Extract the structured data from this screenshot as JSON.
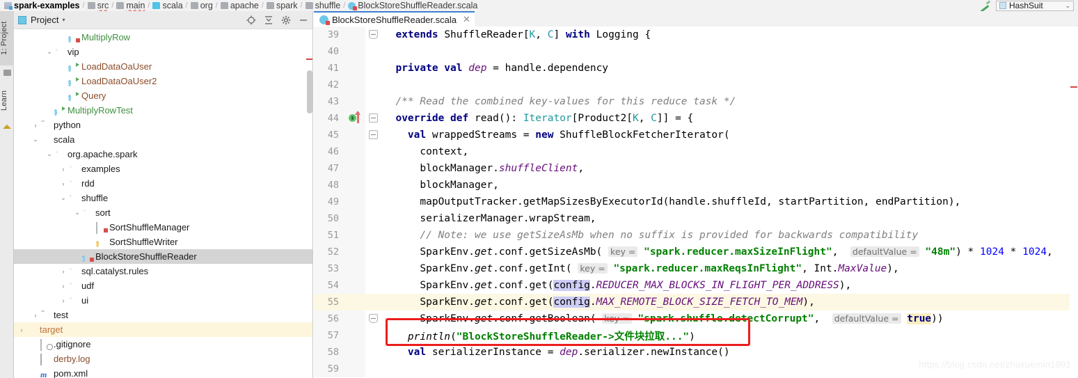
{
  "breadcrumb": {
    "items": [
      {
        "label": "spark-examples",
        "icon": "module-icon",
        "style": "bold"
      },
      {
        "label": "src",
        "icon": "folder-grey-icon",
        "style": "warn"
      },
      {
        "label": "main",
        "icon": "folder-grey-icon",
        "style": "warn"
      },
      {
        "label": "scala",
        "icon": "folder-blue-icon",
        "style": "plain"
      },
      {
        "label": "org",
        "icon": "folder-pkg-icon",
        "style": "plain"
      },
      {
        "label": "apache",
        "icon": "folder-pkg-icon",
        "style": "plain"
      },
      {
        "label": "spark",
        "icon": "folder-pkg-icon",
        "style": "plain"
      },
      {
        "label": "shuffle",
        "icon": "folder-pkg-icon",
        "style": "plain"
      },
      {
        "label": "BlockStoreShuffleReader.scala",
        "icon": "scala-file-icon",
        "style": "plain"
      }
    ],
    "separator": "/"
  },
  "toolbar_right": {
    "magic_wand_icon": "wand-icon",
    "run_configuration": "HashSuit",
    "run_config_chevron": "⌄"
  },
  "tool_window_bar": {
    "tabs": [
      {
        "label": "1: Project",
        "active": true
      },
      {
        "label": "Learn",
        "active": false
      }
    ]
  },
  "project_panel": {
    "title": "Project",
    "title_chevron": "▾",
    "tools": [
      "locate-icon",
      "collapse-all-icon",
      "settings-icon",
      "minimize-icon"
    ],
    "tree": [
      {
        "indent": 5,
        "arrow": "",
        "icon": "scala-class-icon",
        "label": "MultiplyRow",
        "color": "green",
        "state": ""
      },
      {
        "indent": 4,
        "arrow": "⌄",
        "icon": "folder-pkg-icon",
        "label": "vip",
        "color": "dark",
        "state": ""
      },
      {
        "indent": 5,
        "arrow": "",
        "icon": "scala-class-run-icon",
        "label": "LoadDataOaUser",
        "color": "brown",
        "state": ""
      },
      {
        "indent": 5,
        "arrow": "",
        "icon": "scala-class-run-icon",
        "label": "LoadDataOaUser2",
        "color": "brown",
        "state": ""
      },
      {
        "indent": 5,
        "arrow": "",
        "icon": "scala-class-run-icon",
        "label": "Query",
        "color": "brown",
        "state": ""
      },
      {
        "indent": 4,
        "arrow": "",
        "icon": "scala-class-run-icon",
        "label": "MultiplyRowTest",
        "color": "green",
        "state": ""
      },
      {
        "indent": 3,
        "arrow": "›",
        "icon": "folder-grey-icon",
        "label": "python",
        "color": "dark",
        "state": ""
      },
      {
        "indent": 3,
        "arrow": "⌄",
        "icon": "folder-blue-icon",
        "label": "scala",
        "color": "dark",
        "state": ""
      },
      {
        "indent": 4,
        "arrow": "⌄",
        "icon": "folder-pkg-icon",
        "label": "org.apache.spark",
        "color": "dark",
        "state": ""
      },
      {
        "indent": 5,
        "arrow": "›",
        "icon": "folder-pkg-icon",
        "label": "examples",
        "color": "dark",
        "state": ""
      },
      {
        "indent": 5,
        "arrow": "›",
        "icon": "folder-pkg-icon",
        "label": "rdd",
        "color": "dark",
        "state": ""
      },
      {
        "indent": 5,
        "arrow": "⌄",
        "icon": "folder-pkg-icon",
        "label": "shuffle",
        "color": "dark",
        "state": ""
      },
      {
        "indent": 6,
        "arrow": "⌄",
        "icon": "folder-pkg-icon",
        "label": "sort",
        "color": "dark",
        "state": ""
      },
      {
        "indent": 7,
        "arrow": "",
        "icon": "scala-file-icon",
        "label": "SortShuffleManager",
        "color": "dark",
        "state": ""
      },
      {
        "indent": 7,
        "arrow": "",
        "icon": "scala-object-icon",
        "label": "SortShuffleWriter",
        "color": "dark",
        "state": ""
      },
      {
        "indent": 6,
        "arrow": "",
        "icon": "scala-class-icon",
        "label": "BlockStoreShuffleReader",
        "color": "dark",
        "state": "selected"
      },
      {
        "indent": 5,
        "arrow": "›",
        "icon": "folder-pkg-icon",
        "label": "sql.catalyst.rules",
        "color": "dark",
        "state": ""
      },
      {
        "indent": 5,
        "arrow": "›",
        "icon": "folder-pkg-icon",
        "label": "udf",
        "color": "dark",
        "state": ""
      },
      {
        "indent": 5,
        "arrow": "›",
        "icon": "folder-pkg-icon",
        "label": "ui",
        "color": "dark",
        "state": ""
      },
      {
        "indent": 3,
        "arrow": "›",
        "icon": "folder-grey-icon",
        "label": "test",
        "color": "dark",
        "state": ""
      },
      {
        "indent": 2,
        "arrow": "›",
        "icon": "folder-orange-icon",
        "label": "target",
        "color": "orange",
        "state": "highlighted"
      },
      {
        "indent": 3,
        "arrow": "",
        "icon": "gitignore-icon",
        "label": ".gitignore",
        "color": "dark",
        "state": ""
      },
      {
        "indent": 3,
        "arrow": "",
        "icon": "log-file-icon",
        "label": "derby.log",
        "color": "brown",
        "state": ""
      },
      {
        "indent": 3,
        "arrow": "",
        "icon": "maven-icon",
        "label": "pom.xml",
        "color": "dark",
        "state": ""
      }
    ]
  },
  "editor": {
    "tab": {
      "label": "BlockStoreShuffleReader.scala",
      "close": "✕",
      "icon": "scala-class-icon"
    },
    "lines": [
      {
        "num": "39",
        "gutter": "",
        "fold": "pointy",
        "hl": false,
        "tokens": [
          {
            "t": "  ",
            "c": ""
          },
          {
            "t": "extends ",
            "c": "kw"
          },
          {
            "t": "ShuffleReader",
            "c": ""
          },
          {
            "t": "[",
            "c": ""
          },
          {
            "t": "K",
            "c": "typ"
          },
          {
            "t": ", ",
            "c": ""
          },
          {
            "t": "C",
            "c": "typ"
          },
          {
            "t": "] ",
            "c": ""
          },
          {
            "t": "with ",
            "c": "kw"
          },
          {
            "t": "Logging {",
            "c": ""
          }
        ]
      },
      {
        "num": "40",
        "gutter": "",
        "fold": "",
        "hl": false,
        "tokens": []
      },
      {
        "num": "41",
        "gutter": "",
        "fold": "",
        "hl": false,
        "tokens": [
          {
            "t": "  ",
            "c": ""
          },
          {
            "t": "private val ",
            "c": "kw"
          },
          {
            "t": "dep",
            "c": "fld"
          },
          {
            "t": " = handle.dependency",
            "c": ""
          }
        ]
      },
      {
        "num": "42",
        "gutter": "",
        "fold": "",
        "hl": false,
        "tokens": []
      },
      {
        "num": "43",
        "gutter": "",
        "fold": "",
        "hl": false,
        "tokens": [
          {
            "t": "  /** Read the combined key-values for this reduce task */",
            "c": "cmt"
          }
        ]
      },
      {
        "num": "44",
        "gutter": "run-marker",
        "fold": "box",
        "hl": false,
        "tokens": [
          {
            "t": "  ",
            "c": ""
          },
          {
            "t": "override def ",
            "c": "kw"
          },
          {
            "t": "read",
            "c": ""
          },
          {
            "t": "(): ",
            "c": ""
          },
          {
            "t": "Iterator",
            "c": "typ"
          },
          {
            "t": "[Product2[",
            "c": ""
          },
          {
            "t": "K",
            "c": "typ"
          },
          {
            "t": ", ",
            "c": ""
          },
          {
            "t": "C",
            "c": "typ"
          },
          {
            "t": "]] = {",
            "c": ""
          }
        ]
      },
      {
        "num": "45",
        "gutter": "",
        "fold": "box",
        "hl": false,
        "tokens": [
          {
            "t": "    ",
            "c": ""
          },
          {
            "t": "val ",
            "c": "kw"
          },
          {
            "t": "wrappedStreams = ",
            "c": ""
          },
          {
            "t": "new ",
            "c": "kw"
          },
          {
            "t": "ShuffleBlockFetcherIterator(",
            "c": ""
          }
        ]
      },
      {
        "num": "46",
        "gutter": "",
        "fold": "",
        "hl": false,
        "tokens": [
          {
            "t": "      context,",
            "c": ""
          }
        ]
      },
      {
        "num": "47",
        "gutter": "",
        "fold": "",
        "hl": false,
        "tokens": [
          {
            "t": "      blockManager.",
            "c": ""
          },
          {
            "t": "shuffleClient",
            "c": "fld"
          },
          {
            "t": ",",
            "c": ""
          }
        ]
      },
      {
        "num": "48",
        "gutter": "",
        "fold": "",
        "hl": false,
        "tokens": [
          {
            "t": "      blockManager,",
            "c": ""
          }
        ]
      },
      {
        "num": "49",
        "gutter": "",
        "fold": "",
        "hl": false,
        "tokens": [
          {
            "t": "      mapOutputTracker.getMapSizesByExecutorId(handle.shuffleId, startPartition, endPartition),",
            "c": ""
          }
        ]
      },
      {
        "num": "50",
        "gutter": "",
        "fold": "",
        "hl": false,
        "tokens": [
          {
            "t": "      serializerManager.wrapStream,",
            "c": ""
          }
        ]
      },
      {
        "num": "51",
        "gutter": "",
        "fold": "",
        "hl": false,
        "tokens": [
          {
            "t": "      // Note: we use getSizeAsMb when no suffix is provided for backwards compatibility",
            "c": "cmt"
          }
        ]
      },
      {
        "num": "52",
        "gutter": "",
        "fold": "",
        "hl": false,
        "tokens": [
          {
            "t": "      SparkEnv.",
            "c": ""
          },
          {
            "t": "get",
            "c": "stat"
          },
          {
            "t": ".conf.getSizeAsMb( ",
            "c": ""
          },
          {
            "t": "key =",
            "c": "hint"
          },
          {
            "t": " ",
            "c": ""
          },
          {
            "t": "\"spark.reducer.maxSizeInFlight\"",
            "c": "str"
          },
          {
            "t": ",  ",
            "c": ""
          },
          {
            "t": "defaultValue =",
            "c": "hint"
          },
          {
            "t": " ",
            "c": ""
          },
          {
            "t": "\"48m\"",
            "c": "str"
          },
          {
            "t": ") * ",
            "c": ""
          },
          {
            "t": "1024",
            "c": "num"
          },
          {
            "t": " * ",
            "c": ""
          },
          {
            "t": "1024",
            "c": "num"
          },
          {
            "t": ",",
            "c": ""
          }
        ]
      },
      {
        "num": "53",
        "gutter": "",
        "fold": "",
        "hl": false,
        "tokens": [
          {
            "t": "      SparkEnv.",
            "c": ""
          },
          {
            "t": "get",
            "c": "stat"
          },
          {
            "t": ".conf.getInt( ",
            "c": ""
          },
          {
            "t": "key =",
            "c": "hint"
          },
          {
            "t": " ",
            "c": ""
          },
          {
            "t": "\"spark.reducer.maxReqsInFlight\"",
            "c": "str"
          },
          {
            "t": ", Int.",
            "c": ""
          },
          {
            "t": "MaxValue",
            "c": "fld"
          },
          {
            "t": "),",
            "c": ""
          }
        ]
      },
      {
        "num": "54",
        "gutter": "",
        "fold": "",
        "hl": false,
        "tokens": [
          {
            "t": "      SparkEnv.",
            "c": ""
          },
          {
            "t": "get",
            "c": "stat"
          },
          {
            "t": ".conf.get(",
            "c": ""
          },
          {
            "t": "config",
            "c": "sel-tok"
          },
          {
            "t": ".",
            "c": ""
          },
          {
            "t": "REDUCER_MAX_BLOCKS_IN_FLIGHT_PER_ADDRESS",
            "c": "fld"
          },
          {
            "t": "),",
            "c": ""
          }
        ]
      },
      {
        "num": "55",
        "gutter": "",
        "fold": "",
        "hl": true,
        "tokens": [
          {
            "t": "      SparkEnv.",
            "c": ""
          },
          {
            "t": "get",
            "c": "stat"
          },
          {
            "t": ".conf.get(",
            "c": ""
          },
          {
            "t": "config",
            "c": "sel-tok"
          },
          {
            "t": ".",
            "c": ""
          },
          {
            "t": "MAX_REMOTE_BLOCK_SIZE_FETCH_TO_MEM",
            "c": "fld"
          },
          {
            "t": "),",
            "c": ""
          }
        ]
      },
      {
        "num": "56",
        "gutter": "",
        "fold": "pointy",
        "hl": false,
        "tokens": [
          {
            "t": "      SparkEnv.",
            "c": ""
          },
          {
            "t": "get",
            "c": "stat"
          },
          {
            "t": ".conf.getBoolean( ",
            "c": ""
          },
          {
            "t": "key =",
            "c": "hint"
          },
          {
            "t": " ",
            "c": ""
          },
          {
            "t": "\"spark.shuffle.detectCorrupt\"",
            "c": "str"
          },
          {
            "t": ",  ",
            "c": ""
          },
          {
            "t": "defaultValue =",
            "c": "hint"
          },
          {
            "t": " ",
            "c": ""
          },
          {
            "t": "true",
            "c": "kw val-hl"
          },
          {
            "t": "))",
            "c": ""
          }
        ]
      },
      {
        "num": "57",
        "gutter": "",
        "fold": "",
        "hl": false,
        "tokens": [
          {
            "t": "    ",
            "c": ""
          },
          {
            "t": "println",
            "c": "stat"
          },
          {
            "t": "(",
            "c": ""
          },
          {
            "t": "\"BlockStoreShuffleReader->文件块拉取...\"",
            "c": "str"
          },
          {
            "t": ")",
            "c": ""
          }
        ]
      },
      {
        "num": "58",
        "gutter": "",
        "fold": "",
        "hl": false,
        "tokens": [
          {
            "t": "    ",
            "c": ""
          },
          {
            "t": "val ",
            "c": "kw"
          },
          {
            "t": "serializerInstance = ",
            "c": ""
          },
          {
            "t": "dep",
            "c": "fld"
          },
          {
            "t": ".serializer.newInstance()",
            "c": ""
          }
        ]
      },
      {
        "num": "59",
        "gutter": "",
        "fold": "",
        "hl": false,
        "tokens": []
      }
    ]
  },
  "watermark": "https://blog.csdn.net/zhuxuemin1991"
}
